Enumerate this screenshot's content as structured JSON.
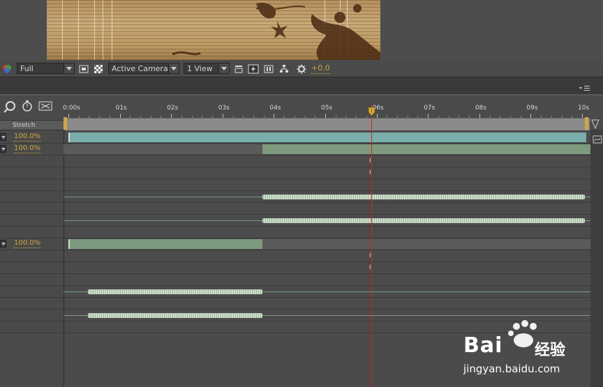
{
  "viewer": {
    "resolution": "Full",
    "camera": "Active Camera",
    "views": "1 View",
    "exposure": "+0.0"
  },
  "timeline": {
    "ruler_labels": [
      "0:00s",
      "01s",
      "02s",
      "03s",
      "04s",
      "05s",
      "06s",
      "07s",
      "08s",
      "09s",
      "10s"
    ],
    "stretch_label": "Stretch",
    "layers": [
      {
        "stretch": "100.0%"
      },
      {
        "stretch": "100.0%"
      },
      {
        "stretch": "100.0%"
      }
    ],
    "current_time_label": "06s"
  },
  "colors": {
    "accent": "#d0a641",
    "time_indicator": "#e02020",
    "video_bar": "#7aaeaa",
    "audio_bar": "#7e9a7e",
    "waveform": "#c6d9c6"
  },
  "watermark": {
    "brand": "Bai",
    "brand2": "经验",
    "url": "jingyan.baidu.com"
  }
}
